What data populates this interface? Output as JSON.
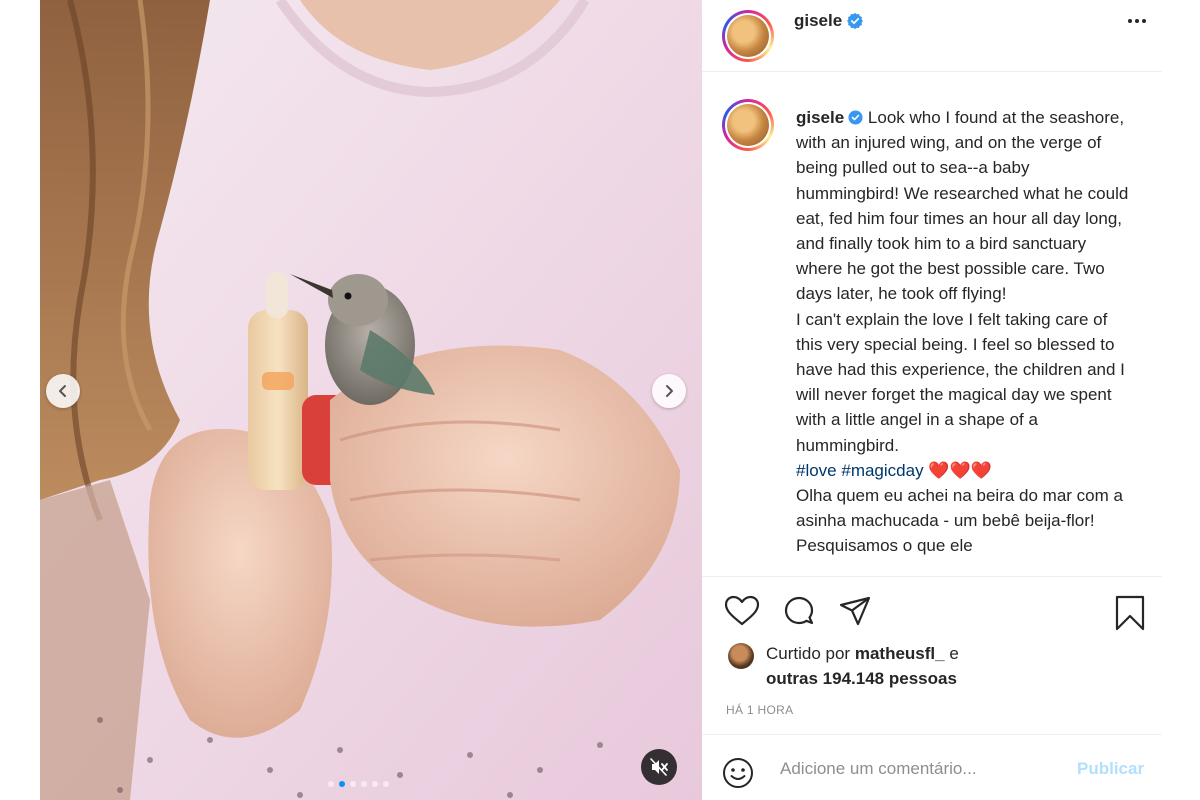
{
  "post": {
    "username": "gisele",
    "verified": true,
    "caption_username": "gisele",
    "caption_en": " Look who I found at the seashore, with an injured wing, and on the verge of being pulled out to sea--a baby hummingbird! We researched what he could eat, fed him four times an hour all day long, and finally took him to a bird sanctuary where he got the best possible care. Two days later, he took off flying!\nI can't explain the love I felt taking care of this very special being. I feel so blessed to have had this experience, the children and I will never forget the magical day we spent with a little angel in a shape of a hummingbird.",
    "hashtags": "#love #magicday",
    "hearts": "❤️❤️❤️",
    "caption_pt": "\nOlha quem eu achei na beira do mar com a asinha machucada - um bebê beija-flor! Pesquisamos o que ele"
  },
  "likes": {
    "prefix": "Curtido por",
    "user": "matheusfl_",
    "connector": " e",
    "others": "outras 194.148 pessoas"
  },
  "time_ago": "HÁ 1 HORA",
  "comment": {
    "placeholder": "Adicione um comentário...",
    "publish_label": "Publicar"
  },
  "carousel": {
    "slide_count": 6,
    "active_index": 1
  },
  "icons": {
    "more": "more-horizontal-icon",
    "like": "heart-icon",
    "comment": "comment-icon",
    "share": "paper-plane-icon",
    "save": "bookmark-icon",
    "emoji": "smiley-icon",
    "mute": "speaker-muted-icon",
    "prev": "chevron-left-icon",
    "next": "chevron-right-icon"
  },
  "colors": {
    "verified": "#3897f0",
    "hashtag": "#00376b",
    "publish_disabled": "#b2dffc",
    "muted_text": "#8e8e8e",
    "active_dot": "#0095f6"
  }
}
